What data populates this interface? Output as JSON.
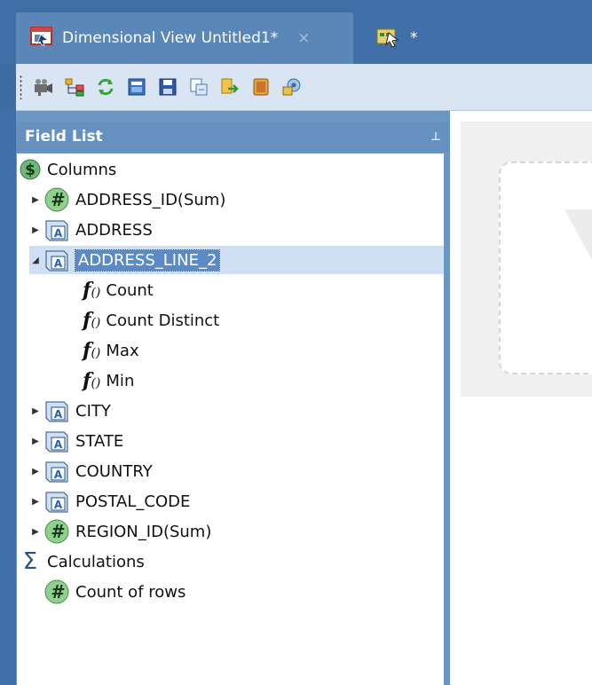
{
  "tabs": {
    "active_label": "Dimensional View Untitled1*",
    "close_glyph": "×",
    "inactive_label": "*"
  },
  "toolbar": {
    "icons": [
      "camera-icon",
      "tree-options-icon",
      "refresh-icon",
      "open-icon",
      "save-icon",
      "export-icon",
      "link-icon",
      "database-icon",
      "settings-icon"
    ]
  },
  "field_list": {
    "title": "Field List",
    "pin_glyph": "⊥",
    "columns_label": "Columns",
    "items": [
      {
        "label": "ADDRESS_ID(Sum)",
        "type": "numeric"
      },
      {
        "label": "ADDRESS",
        "type": "text"
      },
      {
        "label": "ADDRESS_LINE_2",
        "type": "text",
        "expanded": true
      },
      {
        "label": "Count",
        "type": "function"
      },
      {
        "label": "Count Distinct",
        "type": "function"
      },
      {
        "label": "Max",
        "type": "function"
      },
      {
        "label": "Min",
        "type": "function"
      },
      {
        "label": "CITY",
        "type": "text"
      },
      {
        "label": "STATE",
        "type": "text"
      },
      {
        "label": "COUNTRY",
        "type": "text"
      },
      {
        "label": "POSTAL_CODE",
        "type": "text"
      },
      {
        "label": "REGION_ID(Sum)",
        "type": "numeric"
      }
    ],
    "calculations_label": "Calculations",
    "calc_items": [
      {
        "label": "Count of rows",
        "type": "numeric"
      }
    ],
    "function_glyph": "f",
    "function_suffix": "()"
  },
  "colors": {
    "accent": "#3f6fa6",
    "selection": "#5b8bc6",
    "numeric_badge": "#8fd08f",
    "dollar_badge": "#6fb87a"
  }
}
